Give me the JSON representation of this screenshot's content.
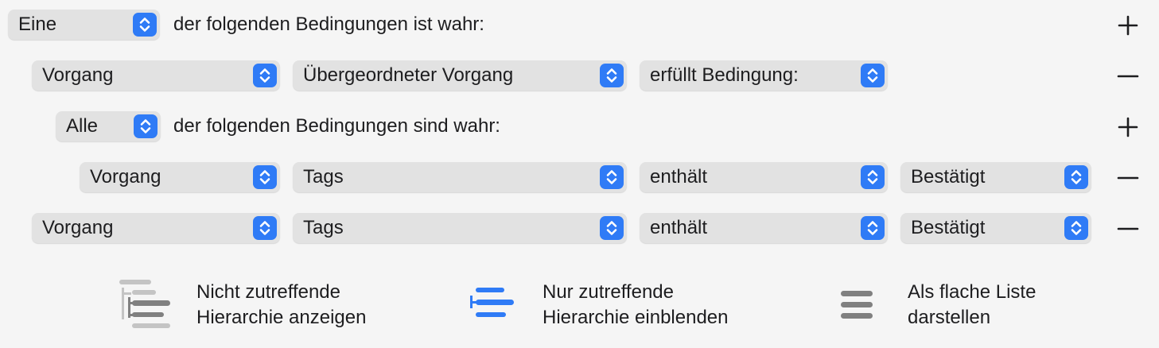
{
  "root": {
    "match_value": "Eine",
    "match_text": "der folgenden Bedingungen ist wahr:"
  },
  "row1": {
    "field": "Vorgang",
    "property": "Übergeordneter Vorgang",
    "operator": "erfüllt Bedingung:"
  },
  "nested": {
    "match_value": "Alle",
    "match_text": "der folgenden Bedingungen sind wahr:"
  },
  "row2": {
    "field": "Vorgang",
    "property": "Tags",
    "operator": "enthält",
    "value": "Bestätigt"
  },
  "row3": {
    "field": "Vorgang",
    "property": "Tags",
    "operator": "enthält",
    "value": "Bestätigt"
  },
  "options": [
    {
      "line1": "Nicht zutreffende",
      "line2": "Hierarchie anzeigen",
      "icon": "hierarchy-gray-icon"
    },
    {
      "line1": "Nur zutreffende",
      "line2": "Hierarchie einblenden",
      "icon": "hierarchy-blue-icon"
    },
    {
      "line1": "Als flache Liste",
      "line2": "darstellen",
      "icon": "flat-list-icon"
    }
  ],
  "colors": {
    "accent": "#2f7bf6",
    "popup_bg": "#e2e2e2",
    "background": "#f5f5f5"
  }
}
